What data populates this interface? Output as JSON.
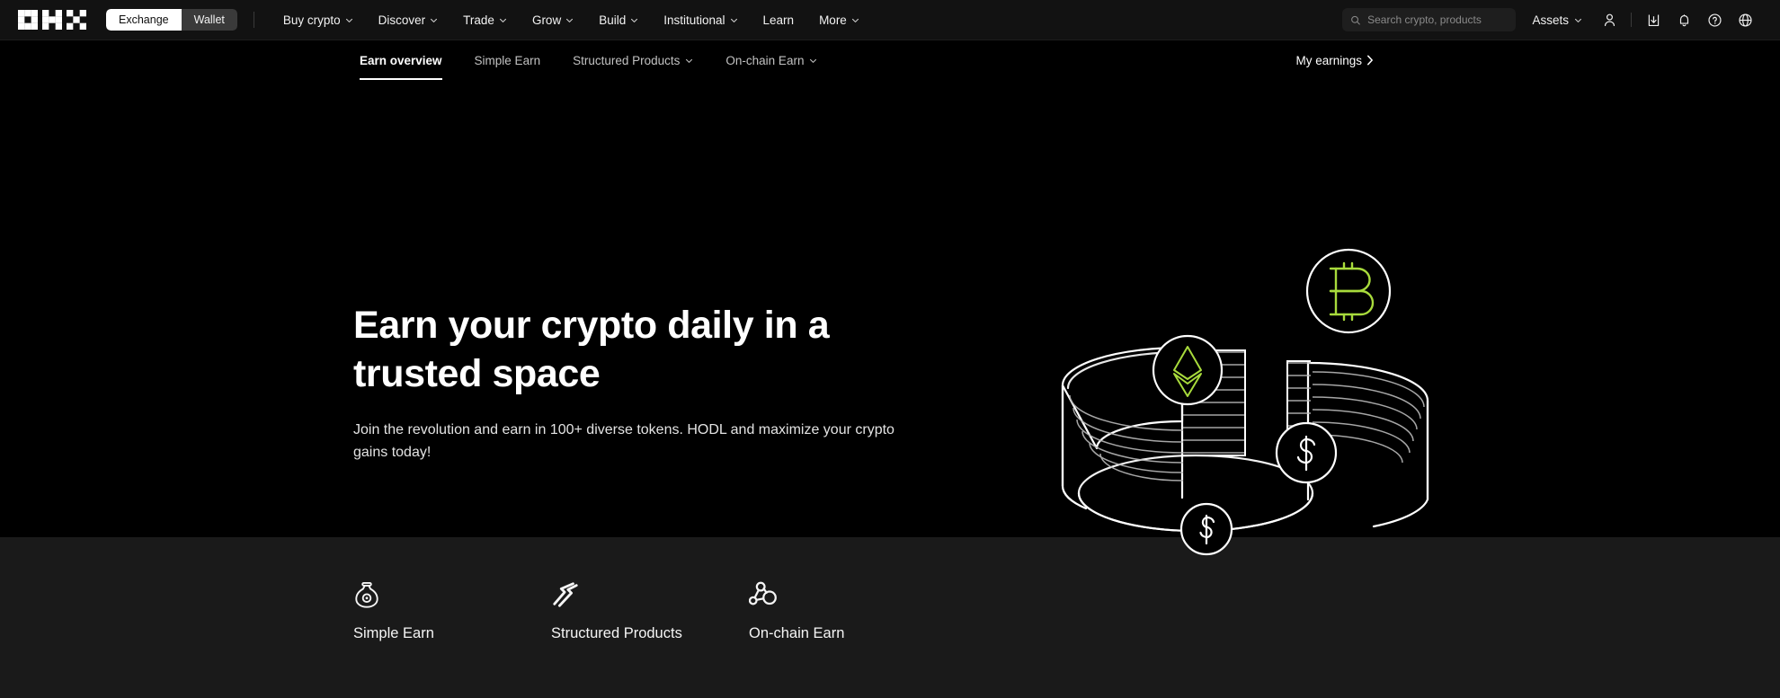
{
  "brand": {
    "logo_name": "OKX",
    "accent_green": "#a8db3c",
    "bg_hero": "#000000",
    "bg_strip": "#1a1a1a",
    "bg_topnav": "#121212"
  },
  "topnav": {
    "segmented": {
      "active": "Exchange",
      "inactive": "Wallet"
    },
    "menu": [
      {
        "label": "Buy crypto",
        "caret": true
      },
      {
        "label": "Discover",
        "caret": true
      },
      {
        "label": "Trade",
        "caret": true
      },
      {
        "label": "Grow",
        "caret": true
      },
      {
        "label": "Build",
        "caret": true
      },
      {
        "label": "Institutional",
        "caret": true
      },
      {
        "label": "Learn",
        "caret": false
      },
      {
        "label": "More",
        "caret": true
      }
    ],
    "search": {
      "placeholder": "Search crypto, products",
      "value": "",
      "icon": "search-icon"
    },
    "assets": {
      "label": "Assets",
      "caret": true
    },
    "icons": [
      "user-icon",
      "download-icon",
      "bell-icon",
      "help-icon",
      "globe-icon"
    ]
  },
  "subnav": {
    "tabs": [
      {
        "label": "Earn overview",
        "active": true,
        "caret": false
      },
      {
        "label": "Simple Earn",
        "active": false,
        "caret": false
      },
      {
        "label": "Structured Products",
        "active": false,
        "caret": true
      },
      {
        "label": "On-chain Earn",
        "active": false,
        "caret": true
      }
    ],
    "my_earnings": {
      "label": "My earnings",
      "chevron": "›"
    }
  },
  "hero": {
    "title": "Earn your crypto daily in a trusted space",
    "subtitle": "Join the revolution and earn in 100+ diverse tokens. HODL and maximize your crypto gains today!",
    "illustration": {
      "name": "crypto-vault-illustration",
      "coins": [
        "ethereum-coin",
        "bitcoin-coin",
        "dollar-coin",
        "dollar-coin"
      ]
    }
  },
  "products": [
    {
      "label": "Simple Earn",
      "icon": "money-bag-icon"
    },
    {
      "label": "Structured Products",
      "icon": "zigzag-chart-icon"
    },
    {
      "label": "On-chain Earn",
      "icon": "network-nodes-icon"
    }
  ]
}
